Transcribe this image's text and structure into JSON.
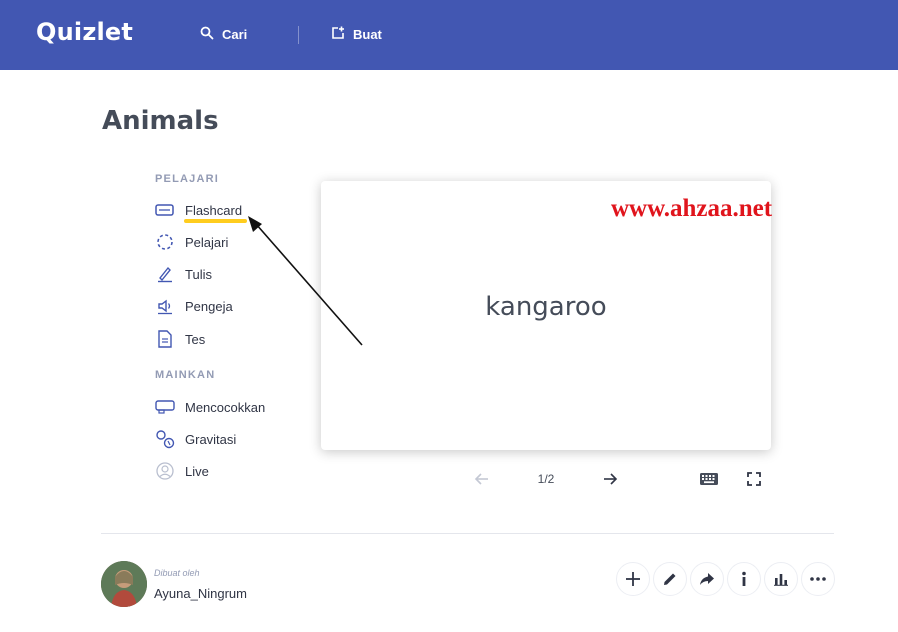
{
  "header": {
    "logo": "Quizlet",
    "search_label": "Cari",
    "create_label": "Buat",
    "brand_color": "#4257b2"
  },
  "page": {
    "title": "Animals"
  },
  "modes": {
    "study_section": "PELAJARI",
    "study_items": [
      {
        "label": "Flashcard",
        "icon": "flashcard-icon",
        "active": true
      },
      {
        "label": "Pelajari",
        "icon": "learn-icon"
      },
      {
        "label": "Tulis",
        "icon": "write-icon"
      },
      {
        "label": "Pengeja",
        "icon": "spell-icon"
      },
      {
        "label": "Tes",
        "icon": "test-icon"
      }
    ],
    "play_section": "MAINKAN",
    "play_items": [
      {
        "label": "Mencocokkan",
        "icon": "match-icon"
      },
      {
        "label": "Gravitasi",
        "icon": "gravity-icon"
      },
      {
        "label": "Live",
        "icon": "live-icon"
      }
    ],
    "active_color": "#ffcd1f"
  },
  "flashcard": {
    "term": "kangaroo",
    "counter": "1/2"
  },
  "watermark": "www.ahzaa.net",
  "creator": {
    "created_by_label": "Dibuat oleh",
    "username": "Ayuna_Ningrum"
  }
}
